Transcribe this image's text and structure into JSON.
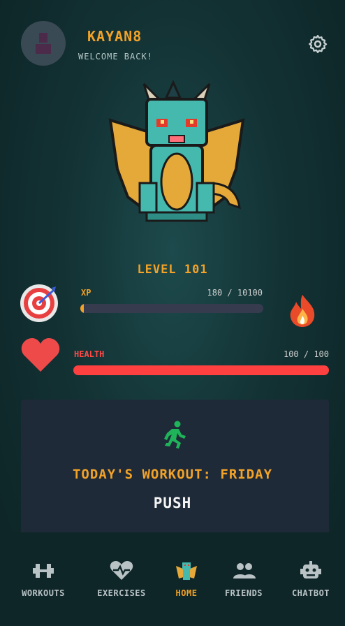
{
  "header": {
    "username": "KAYAN8",
    "welcome": "WELCOME BACK!",
    "avatar_icon": "user-avatar-icon",
    "settings_icon": "gear-icon"
  },
  "character": {
    "image": "pixel-dragon",
    "level_label": "LEVEL 101"
  },
  "xp": {
    "label": "XP",
    "value_text": "180 / 10100",
    "current": 180,
    "max": 10100,
    "color": "#f2a227"
  },
  "health": {
    "label": "HEALTH",
    "value_text": "100 / 100",
    "current": 100,
    "max": 100,
    "color": "#ff4040"
  },
  "workout": {
    "title": "TODAY'S WORKOUT: FRIDAY",
    "type": "PUSH",
    "icon": "running-person-icon"
  },
  "nav": {
    "items": [
      {
        "label": "WORKOUTS",
        "icon": "dumbbell-icon"
      },
      {
        "label": "EXERCISES",
        "icon": "heart-pulse-icon"
      },
      {
        "label": "HOME",
        "icon": "dragon-icon",
        "active": true
      },
      {
        "label": "FRIENDS",
        "icon": "users-icon"
      },
      {
        "label": "CHATBOT",
        "icon": "robot-icon"
      }
    ]
  },
  "colors": {
    "accent": "#f2a227",
    "danger": "#ff4040",
    "background": "#133234",
    "card": "#1f2a38"
  }
}
